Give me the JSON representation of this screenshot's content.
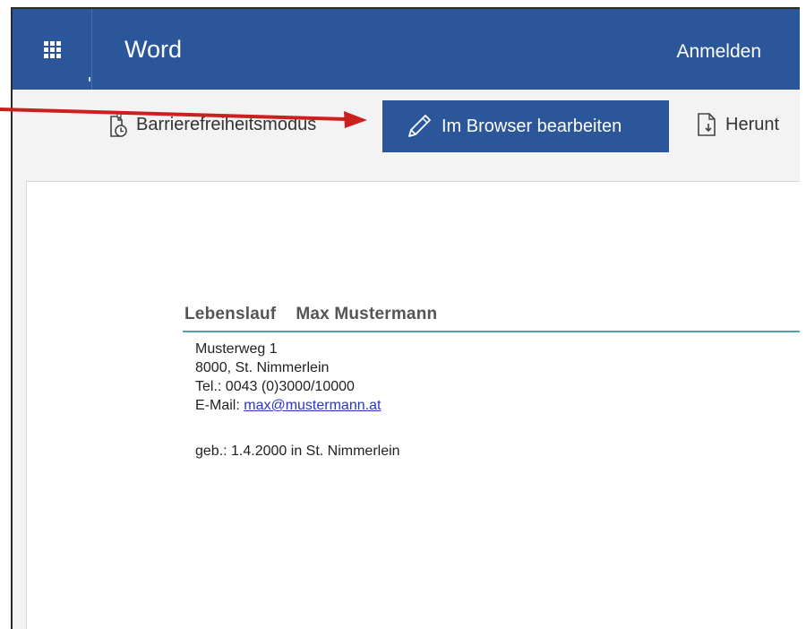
{
  "header": {
    "app_title": "Word",
    "signin_label": "Anmelden",
    "background_color": "#2b579a"
  },
  "toolbar": {
    "accessibility_label": "Barrierefreiheitsmodus",
    "edit_label": "Im Browser bearbeiten",
    "download_label": "Herunt",
    "accessibility_icon": "accessibility-document-icon",
    "edit_icon": "pencil-icon",
    "download_icon": "download-document-icon"
  },
  "document": {
    "heading_left": "Lebenslauf",
    "heading_right": "Max Mustermann",
    "address_line1": "Musterweg 1",
    "address_line2": "8000, St. Nimmerlein",
    "phone": "Tel.: 0043 (0)3000/10000",
    "email_prefix": "E-Mail: ",
    "email": "max@mustermann.at",
    "birth": "geb.: 1.4.2000 in St. Nimmerlein",
    "rule_color": "#4fa3a8"
  },
  "annotation": {
    "arrow_color": "#cc1f1f"
  }
}
